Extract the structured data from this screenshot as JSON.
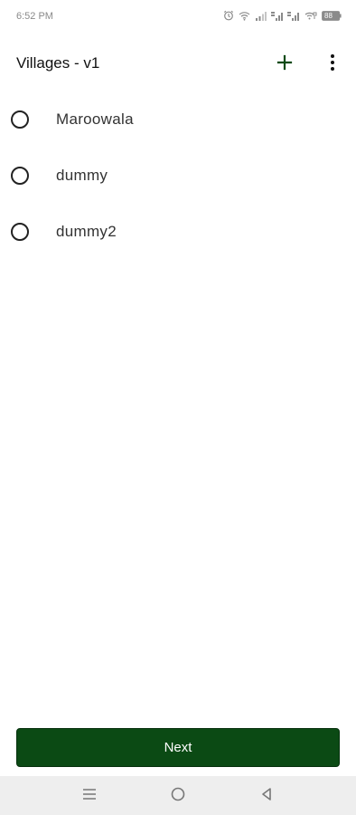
{
  "status_bar": {
    "time": "6:52 PM",
    "battery_label": "88"
  },
  "app_bar": {
    "title": "Villages - v1",
    "add_icon": "plus-icon",
    "more_icon": "more-vert-icon"
  },
  "villages": [
    {
      "label": "Maroowala",
      "selected": false
    },
    {
      "label": "dummy",
      "selected": false
    },
    {
      "label": "dummy2",
      "selected": false
    }
  ],
  "footer": {
    "next_label": "Next",
    "accent_color": "#0b4a14"
  },
  "nav_bar": {
    "icons": [
      "menu-icon",
      "home-circle-icon",
      "back-triangle-icon"
    ]
  }
}
